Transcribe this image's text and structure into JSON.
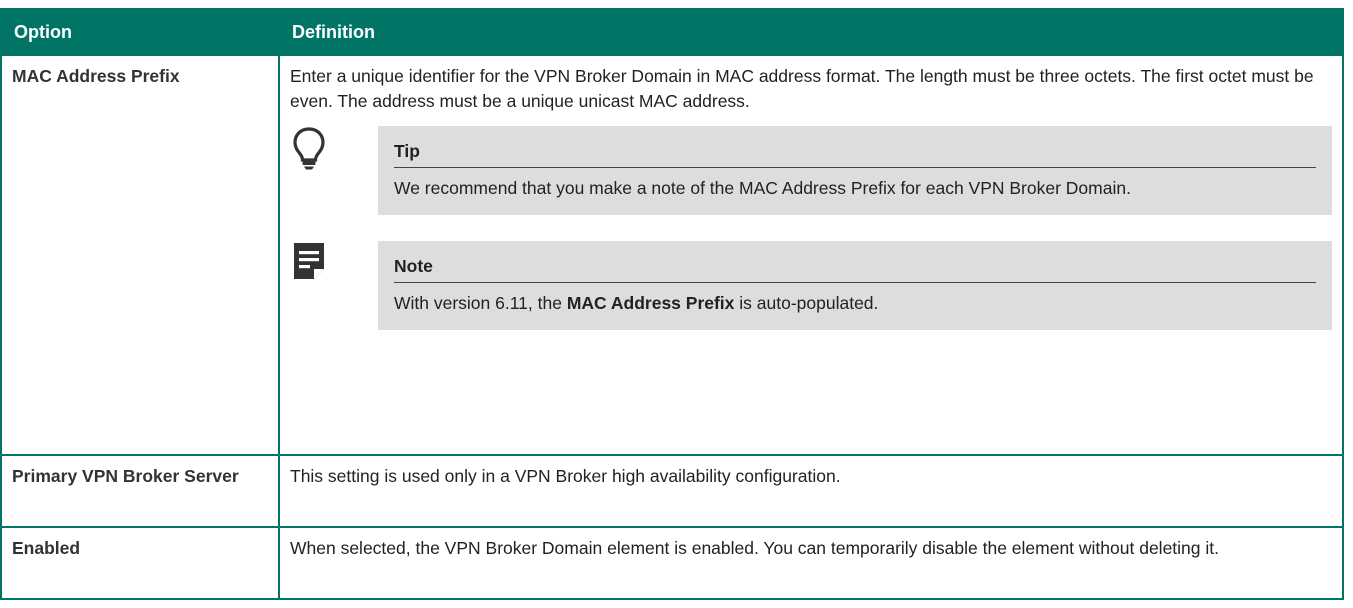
{
  "header": {
    "option": "Option",
    "definition": "Definition"
  },
  "rows": [
    {
      "option": "MAC Address Prefix",
      "definition": "Enter a unique identifier for the VPN Broker Domain in MAC address format. The length must be three octets. The first octet must be even. The address must be a unique unicast MAC address.",
      "tip": {
        "icon": "lightbulb-icon",
        "title": "Tip",
        "text": "We recommend that you make a note of the MAC Address Prefix for each VPN Broker Domain."
      },
      "note": {
        "icon": "note-icon",
        "title": "Note",
        "text_before": "With version 6.11, the ",
        "text_bold": "MAC Address Prefix",
        "text_after": " is auto-populated."
      }
    },
    {
      "option": "Primary VPN Broker Server",
      "definition": "This setting is used only in a VPN Broker high availability configuration."
    },
    {
      "option": "Enabled",
      "definition": "When selected, the VPN Broker Domain element is enabled. You can temporarily disable the element without deleting it."
    }
  ],
  "colors": {
    "header_bg": "#007566",
    "admonition_bg": "#dddddd"
  }
}
